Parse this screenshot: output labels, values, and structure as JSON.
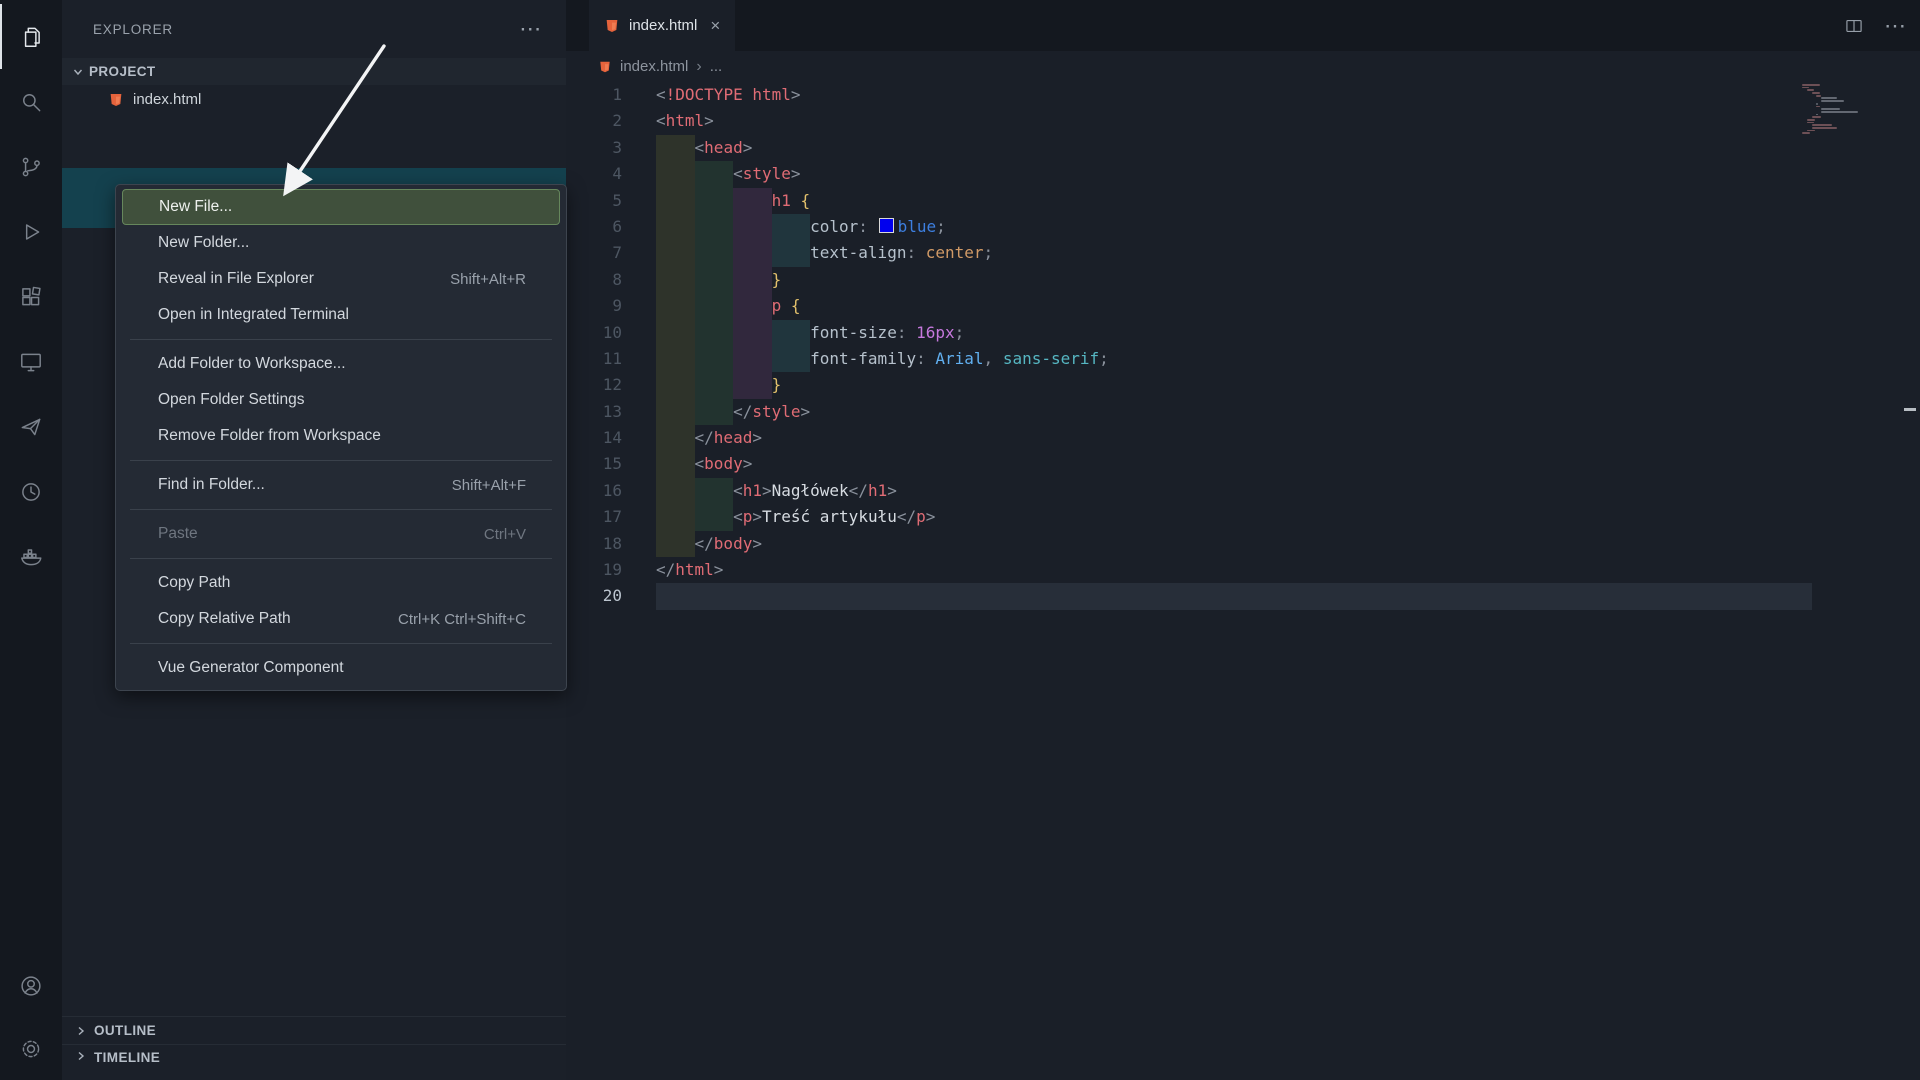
{
  "activity_bar": {
    "items": [
      "explorer",
      "search",
      "source-control",
      "run-and-debug",
      "extensions",
      "remote-explorer",
      "share",
      "history",
      "docker",
      "account",
      "settings"
    ],
    "active_item": "explorer"
  },
  "sidebar": {
    "title": "EXPLORER",
    "more_label": "⋯",
    "project_section": "PROJECT",
    "files": [
      {
        "name": "index.html"
      }
    ],
    "outline_section": "OUTLINE",
    "timeline_section": "TIMELINE"
  },
  "context_menu": {
    "items": [
      {
        "label": "New File...",
        "highlighted": true
      },
      {
        "label": "New Folder..."
      },
      {
        "label": "Reveal in File Explorer",
        "shortcut": "Shift+Alt+R"
      },
      {
        "label": "Open in Integrated Terminal"
      },
      {
        "separator": true
      },
      {
        "label": "Add Folder to Workspace..."
      },
      {
        "label": "Open Folder Settings"
      },
      {
        "label": "Remove Folder from Workspace"
      },
      {
        "separator": true
      },
      {
        "label": "Find in Folder...",
        "shortcut": "Shift+Alt+F"
      },
      {
        "separator": true
      },
      {
        "label": "Paste",
        "shortcut": "Ctrl+V",
        "disabled": true
      },
      {
        "separator": true
      },
      {
        "label": "Copy Path"
      },
      {
        "label": "Copy Relative Path",
        "shortcut": "Ctrl+K Ctrl+Shift+C"
      },
      {
        "separator": true
      },
      {
        "label": "Vue Generator Component"
      }
    ]
  },
  "editor": {
    "tab": {
      "label": "index.html",
      "close_label": "×"
    },
    "actions": {
      "more_label": "⋯"
    },
    "breadcrumb": {
      "file": "index.html",
      "separator": "›",
      "more": "..."
    },
    "code": {
      "current_line": 20,
      "lines": [
        {
          "n": 1,
          "indent": 0,
          "tokens": [
            [
              "<",
              "pu"
            ],
            [
              "!DOCTYPE",
              "tag"
            ],
            [
              " ",
              "plain"
            ],
            [
              "html",
              "tag"
            ],
            [
              ">",
              "pu"
            ]
          ]
        },
        {
          "n": 2,
          "indent": 0,
          "tokens": [
            [
              "<",
              "pu"
            ],
            [
              "html",
              "tag"
            ],
            [
              ">",
              "pu"
            ]
          ]
        },
        {
          "n": 3,
          "indent": 1,
          "tokens": [
            [
              "<",
              "pu"
            ],
            [
              "head",
              "tag"
            ],
            [
              ">",
              "pu"
            ]
          ]
        },
        {
          "n": 4,
          "indent": 2,
          "tokens": [
            [
              "<",
              "pu"
            ],
            [
              "style",
              "tag"
            ],
            [
              ">",
              "pu"
            ]
          ]
        },
        {
          "n": 5,
          "indent": 3,
          "tokens": [
            [
              "h1",
              "tag"
            ],
            [
              " ",
              "plain"
            ],
            [
              "{",
              "br"
            ]
          ]
        },
        {
          "n": 6,
          "indent": 4,
          "tokens": [
            [
              "color",
              "prop"
            ],
            [
              ":",
              "pu"
            ],
            [
              " ",
              "plain"
            ],
            [
              "",
              "swatch"
            ],
            [
              "blue",
              "vblue"
            ],
            [
              ";",
              "pu"
            ]
          ]
        },
        {
          "n": 7,
          "indent": 4,
          "tokens": [
            [
              "text-align",
              "prop"
            ],
            [
              ":",
              "pu"
            ],
            [
              " ",
              "plain"
            ],
            [
              "center",
              "vorange"
            ],
            [
              ";",
              "pu"
            ]
          ]
        },
        {
          "n": 8,
          "indent": 3,
          "tokens": [
            [
              "}",
              "br"
            ]
          ]
        },
        {
          "n": 9,
          "indent": 3,
          "tokens": [
            [
              "p",
              "tag"
            ],
            [
              " ",
              "plain"
            ],
            [
              "{",
              "br"
            ]
          ]
        },
        {
          "n": 10,
          "indent": 4,
          "tokens": [
            [
              "font-size",
              "prop"
            ],
            [
              ":",
              "pu"
            ],
            [
              " ",
              "plain"
            ],
            [
              "16px",
              "vpurple"
            ],
            [
              ";",
              "pu"
            ]
          ]
        },
        {
          "n": 11,
          "indent": 4,
          "tokens": [
            [
              "font-family",
              "prop"
            ],
            [
              ":",
              "pu"
            ],
            [
              " ",
              "plain"
            ],
            [
              "Arial",
              "vblue2"
            ],
            [
              ",",
              "pu"
            ],
            [
              " ",
              "plain"
            ],
            [
              "sans-serif",
              "vcyan"
            ],
            [
              ";",
              "pu"
            ]
          ]
        },
        {
          "n": 12,
          "indent": 3,
          "tokens": [
            [
              "}",
              "br"
            ]
          ]
        },
        {
          "n": 13,
          "indent": 2,
          "tokens": [
            [
              "</",
              "pu"
            ],
            [
              "style",
              "tag"
            ],
            [
              ">",
              "pu"
            ]
          ]
        },
        {
          "n": 14,
          "indent": 1,
          "tokens": [
            [
              "</",
              "pu"
            ],
            [
              "head",
              "tag"
            ],
            [
              ">",
              "pu"
            ]
          ]
        },
        {
          "n": 15,
          "indent": 1,
          "tokens": [
            [
              "<",
              "pu"
            ],
            [
              "body",
              "tag"
            ],
            [
              ">",
              "pu"
            ]
          ]
        },
        {
          "n": 16,
          "indent": 2,
          "tokens": [
            [
              "<",
              "pu"
            ],
            [
              "h1",
              "tag"
            ],
            [
              ">",
              "pu"
            ],
            [
              "Nagłówek",
              "txt"
            ],
            [
              "</",
              "pu"
            ],
            [
              "h1",
              "tag"
            ],
            [
              ">",
              "pu"
            ]
          ]
        },
        {
          "n": 17,
          "indent": 2,
          "tokens": [
            [
              "<",
              "pu"
            ],
            [
              "p",
              "tag"
            ],
            [
              ">",
              "pu"
            ],
            [
              "Treść artykułu",
              "txt"
            ],
            [
              "</",
              "pu"
            ],
            [
              "p",
              "tag"
            ],
            [
              ">",
              "pu"
            ]
          ]
        },
        {
          "n": 18,
          "indent": 1,
          "tokens": [
            [
              "</",
              "pu"
            ],
            [
              "body",
              "tag"
            ],
            [
              ">",
              "pu"
            ]
          ]
        },
        {
          "n": 19,
          "indent": 0,
          "tokens": [
            [
              "</",
              "pu"
            ],
            [
              "html",
              "tag"
            ],
            [
              ">",
              "pu"
            ]
          ]
        },
        {
          "n": 20,
          "indent": 0,
          "tokens": []
        }
      ]
    }
  },
  "colors": {
    "tag_red": "#e06c75",
    "punctuation_gray": "#8a919c",
    "brace_gold": "#e2c06c",
    "property_gray": "#b6c1cc",
    "value_blue": "#3d7fe0",
    "value_orange": "#d19a66",
    "value_purple": "#c678dd",
    "value_cyan": "#56b6c2",
    "swatch_blue": "#0000ee",
    "file_icon_orange": "#e5633c",
    "menu_highlight_green": "#40503c",
    "menu_highlight_border": "#66875c",
    "drop_target_teal": "#14414e"
  },
  "annotation": {
    "type": "arrow",
    "points_at": "New File..."
  }
}
